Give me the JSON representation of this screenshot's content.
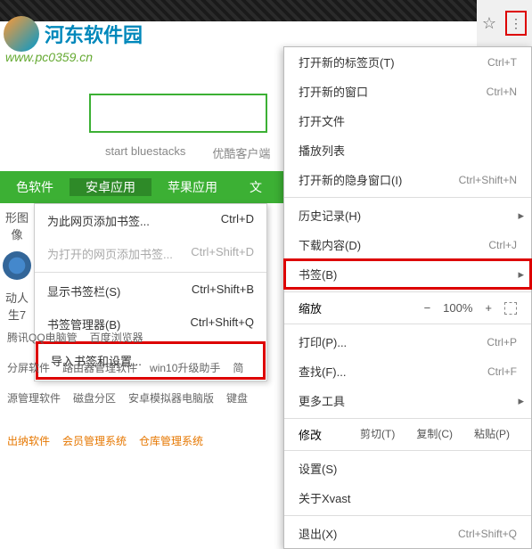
{
  "logo": {
    "text": "河东软件园",
    "url": "www.pc0359.cn"
  },
  "search": {
    "labels": [
      "start bluestacks",
      "优酷客户端"
    ]
  },
  "nav": {
    "items": [
      "色软件",
      "安卓应用",
      "苹果应用",
      "文"
    ]
  },
  "submenu": {
    "add": "为此网页添加书签...",
    "add_sc": "Ctrl+D",
    "addopen": "为打开的网页添加书签...",
    "addopen_sc": "Ctrl+Shift+D",
    "showbar": "显示书签栏(S)",
    "showbar_sc": "Ctrl+Shift+B",
    "manager": "书签管理器(B)",
    "manager_sc": "Ctrl+Shift+Q",
    "import": "导入书签和设置..."
  },
  "left": {
    "a": "形图像",
    "b": "动人生7",
    "c": "腾讯QQ电脑管",
    "d": "百度浏览器"
  },
  "rows": {
    "r1": [
      "分屏软件",
      "路由器管理软件",
      "win10升级助手",
      "简"
    ],
    "r2": [
      "源管理软件",
      "磁盘分区",
      "安卓模拟器电脑版",
      "键盘"
    ],
    "r3": [
      "出纳软件",
      "会员管理系统",
      "仓库管理系统"
    ]
  },
  "menu": {
    "newtab": "打开新的标签页(T)",
    "newtab_sc": "Ctrl+T",
    "newwin": "打开新的窗口",
    "newwin_sc": "Ctrl+N",
    "openfile": "打开文件",
    "playlist": "播放列表",
    "incog": "打开新的隐身窗口(I)",
    "incog_sc": "Ctrl+Shift+N",
    "history": "历史记录(H)",
    "downloads": "下载内容(D)",
    "downloads_sc": "Ctrl+J",
    "bookmarks": "书签(B)",
    "zoom": "缩放",
    "zoom_val": "100%",
    "print": "打印(P)...",
    "print_sc": "Ctrl+P",
    "find": "查找(F)...",
    "find_sc": "Ctrl+F",
    "tools": "更多工具",
    "edit": "修改",
    "cut": "剪切(T)",
    "copy": "复制(C)",
    "paste": "粘贴(P)",
    "settings": "设置(S)",
    "about": "关于Xvast",
    "exit": "退出(X)",
    "exit_sc": "Ctrl+Shift+Q"
  }
}
